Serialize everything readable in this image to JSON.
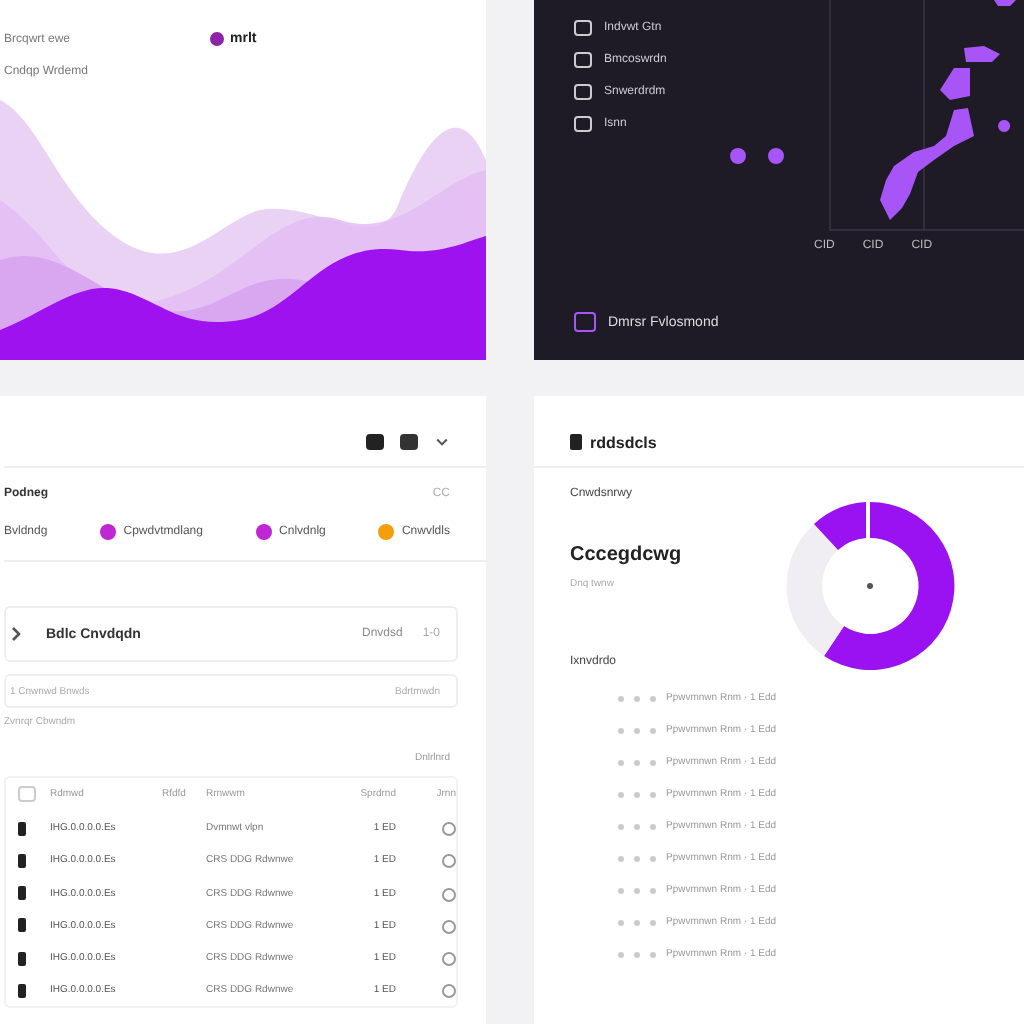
{
  "wave_card": {
    "caption": "Brcqwrt ewe",
    "subcaption": "Cndqp Wrdemd",
    "legend": {
      "label": "mrlt",
      "color": "#8e24aa"
    }
  },
  "dark_panel": {
    "menu": [
      {
        "label": "Indvwt Gtn"
      },
      {
        "label": "Bmcoswrdn"
      },
      {
        "label": "Snwerdrdm"
      },
      {
        "label": "Isnn"
      }
    ],
    "axis_labels": [
      "CID",
      "CID",
      "CID"
    ],
    "footer": "Dmrsr Fvlosmond"
  },
  "list_card": {
    "section": "Podneg",
    "section_note": "CC",
    "legend": [
      {
        "label": "Bvldndg"
      },
      {
        "label": "Cpwdvtmdlang",
        "color": "#c026d3"
      },
      {
        "label": "Cnlvdnlg",
        "color": "#c026d3"
      },
      {
        "label": "Cnwvldls",
        "color": "#f59e0b"
      }
    ],
    "group": {
      "title": "Bdlc Cnvdqdn",
      "status": "Dnvdsd",
      "count": "1-0",
      "expanded": false
    },
    "filter": {
      "placeholder": "1 Cnwnwd Bnwds",
      "action": "Bdrtmwdn"
    },
    "note": "Zvnrqr Cbwndm",
    "table_link": "Dnlrlnrd",
    "table": {
      "select_all": {
        "checked": false
      },
      "columns": [
        "Rdmwd",
        "Rfdfd",
        "Rrnwwm",
        "Sprdrnd",
        "Jrnn"
      ],
      "rows": [
        [
          "IHG.0.0.0.0.Es",
          "",
          "Dvmnwt vlpn",
          "1 ED"
        ],
        [
          "IHG.0.0.0.0.Es",
          "",
          "CRS DDG Rdwnwe",
          "1 ED"
        ],
        [
          "IHG.0.0.0.0.Es",
          "",
          "CRS DDG Rdwnwe",
          "1 ED"
        ],
        [
          "IHG.0.0.0.0.Es",
          "",
          "CRS DDG Rdwnwe",
          "1 ED"
        ],
        [
          "IHG.0.0.0.0.Es",
          "",
          "CRS DDG Rdwnwe",
          "1 ED"
        ],
        [
          "IHG.0.0.0.0.Es",
          "",
          "CRS DDG Rdwnwe",
          "1 ED"
        ]
      ]
    }
  },
  "donut_card": {
    "title": "rddsdcls",
    "label": "Cnwdsnrwy",
    "value": "Cccegdcwg",
    "value_note": "Dnq twnw",
    "list_title": "Ixnvdrdo",
    "items": [
      "Ppwvmnwn Rnm · 1 Edd",
      "Ppwvmnwn Rnm · 1 Edd",
      "Ppwvmnwn Rnm · 1 Edd",
      "Ppwvmnwn Rnm · 1 Edd",
      "Ppwvmnwn Rnm · 1 Edd",
      "Ppwvmnwn Rnm · 1 Edd",
      "Ppwvmnwn Rnm · 1 Edd",
      "Ppwvmnwn Rnm · 1 Edd",
      "Ppwvmnwn Rnm · 1 Edd"
    ]
  }
}
